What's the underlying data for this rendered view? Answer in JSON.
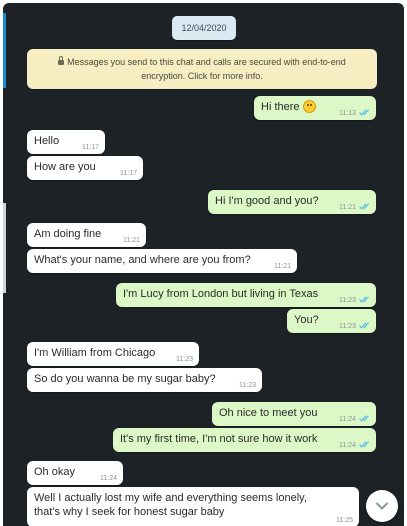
{
  "date": "12/04/2020",
  "encryption_notice": "Messages you send to this chat and calls are secured with end-to-end encryption. Click for more info.",
  "colors": {
    "background": "#1c2226",
    "incoming": "#ffffff",
    "outgoing": "#dcf8c6",
    "tick": "#4fb6ec"
  },
  "icons": {
    "lock": "lock-icon",
    "read_receipt": "double-check-icon",
    "emoji": "smiley-emoji",
    "scroll_down": "chevron-down-icon"
  },
  "messages": [
    {
      "dir": "out",
      "text": "Hi there",
      "time": "11:13",
      "emoji": true
    },
    {
      "dir": "in",
      "text": "Hello",
      "time": "11:17"
    },
    {
      "dir": "in",
      "text": "How are you",
      "time": "11:17"
    },
    {
      "dir": "out",
      "text": "Hi I'm good and you?",
      "time": "11:21"
    },
    {
      "dir": "in",
      "text": "Am doing fine",
      "time": "11:21"
    },
    {
      "dir": "in",
      "text": "What's your name, and where are you from?",
      "time": "11:21"
    },
    {
      "dir": "out",
      "text": "I'm Lucy from London but living in Texas",
      "time": "11:23"
    },
    {
      "dir": "out",
      "text": "You?",
      "time": "11:23"
    },
    {
      "dir": "in",
      "text": "I'm William from Chicago",
      "time": "11:23"
    },
    {
      "dir": "in",
      "text": "So do you wanna be my sugar baby?",
      "time": "11:23"
    },
    {
      "dir": "out",
      "text": "Oh nice to meet you",
      "time": "11:24"
    },
    {
      "dir": "out",
      "text": "It's my first time, I'm not sure how it work",
      "time": "11:24"
    },
    {
      "dir": "in",
      "text": "Oh okay",
      "time": "11:24"
    },
    {
      "dir": "in",
      "text": "Well I actually lost my wife and everything seems lonely, that's why I seek for honest sugar baby",
      "time": "11:25"
    }
  ]
}
